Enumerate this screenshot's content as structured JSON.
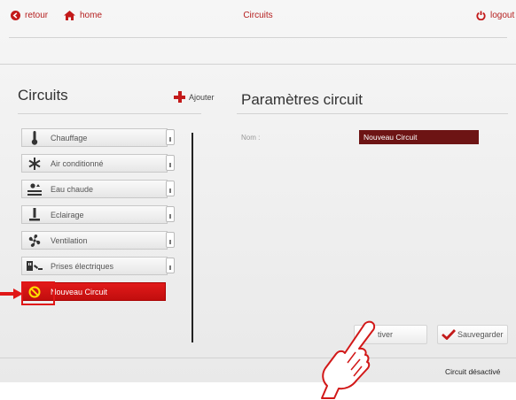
{
  "topbar": {
    "back_label": "retour",
    "home_label": "home",
    "title": "Circuits",
    "logout_label": "logout"
  },
  "left_panel": {
    "title": "Circuits",
    "add_label": "Ajouter",
    "circuits": [
      {
        "label": "Chauffage",
        "icon": "thermometer-icon"
      },
      {
        "label": "Air conditionné",
        "icon": "snowflake-icon"
      },
      {
        "label": "Eau chaude",
        "icon": "water-heater-icon"
      },
      {
        "label": "Eclairage",
        "icon": "lamp-icon"
      },
      {
        "label": "Ventilation",
        "icon": "fan-icon"
      },
      {
        "label": "Prises électriques",
        "icon": "plug-icon"
      }
    ],
    "selected_circuit": {
      "label": "Nouveau Circuit",
      "icon": "prohibited-icon"
    }
  },
  "right_panel": {
    "title": "Paramètres circuit",
    "name_label": "Nom :",
    "name_value": "Nouveau Circuit",
    "activate_label": "tiver",
    "save_label": "Sauvegarder",
    "status": "Circuit désactivé"
  },
  "colors": {
    "accent": "#c31a1a",
    "selected_bg": "#d41414",
    "input_bg": "#6d1414"
  }
}
